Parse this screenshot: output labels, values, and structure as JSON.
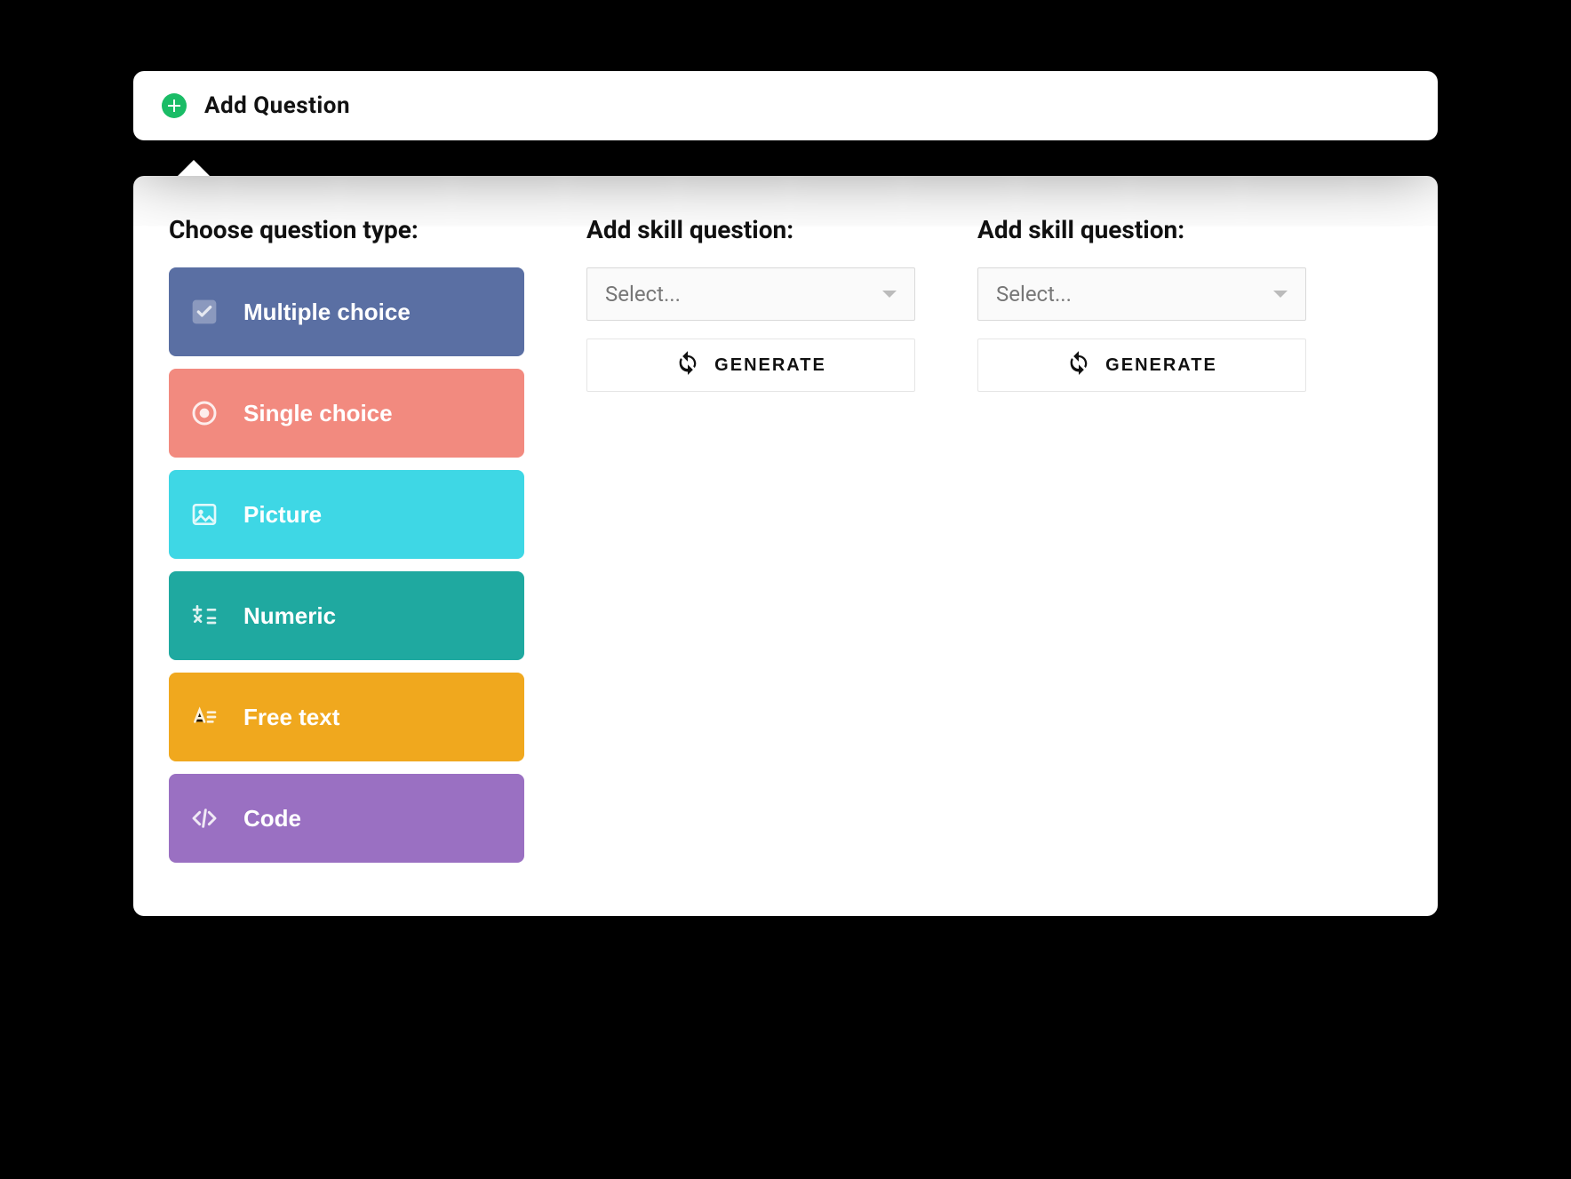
{
  "header": {
    "title": "Add  Question"
  },
  "panel": {
    "question_type_heading": "Choose question type:",
    "types": [
      {
        "label": "Multiple choice"
      },
      {
        "label": "Single choice"
      },
      {
        "label": "Picture"
      },
      {
        "label": "Numeric"
      },
      {
        "label": "Free text"
      },
      {
        "label": "Code"
      }
    ],
    "skill_columns": [
      {
        "heading": "Add skill question:",
        "select_placeholder": "Select...",
        "generate_label": "GENERATE"
      },
      {
        "heading": "Add skill question:",
        "select_placeholder": "Select...",
        "generate_label": "GENERATE"
      }
    ]
  }
}
